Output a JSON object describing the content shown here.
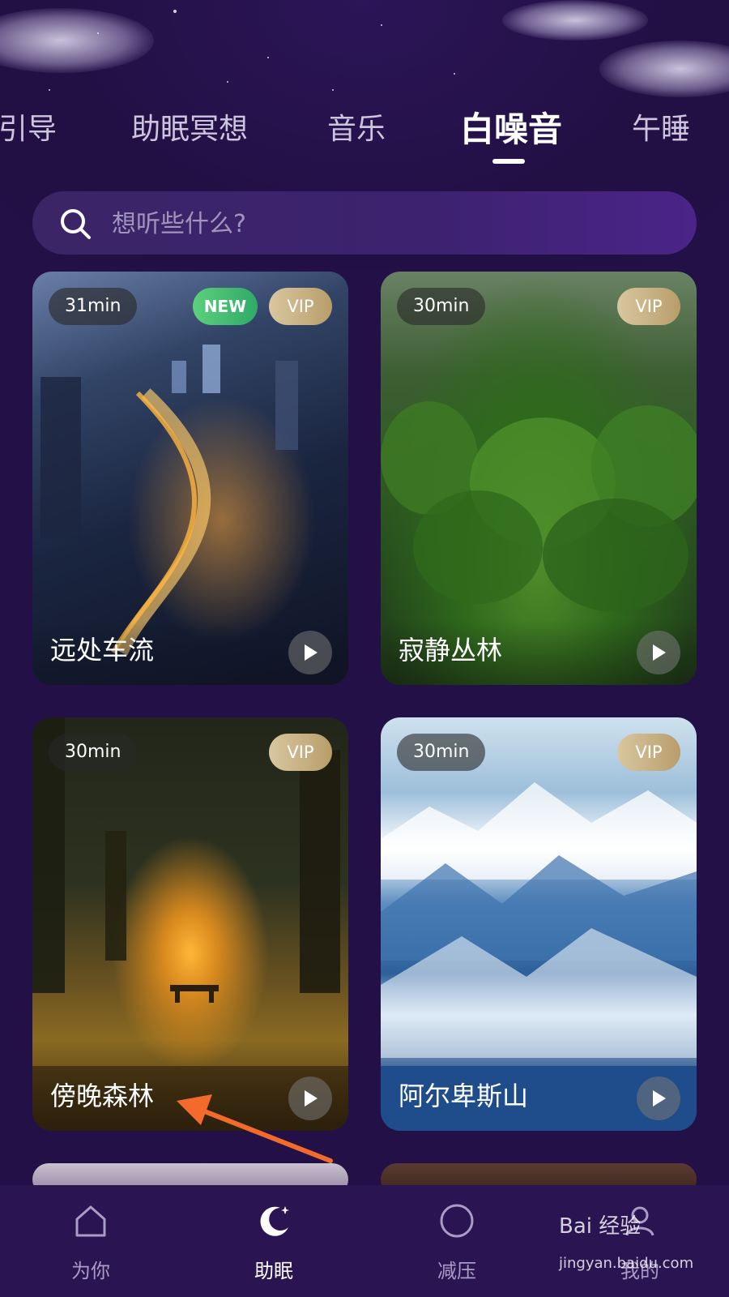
{
  "tabs": [
    {
      "label": "引导"
    },
    {
      "label": "助眠冥想"
    },
    {
      "label": "音乐"
    },
    {
      "label": "白噪音",
      "active": true
    },
    {
      "label": "午睡"
    }
  ],
  "search": {
    "placeholder": "想听些什么?"
  },
  "cards": [
    {
      "title": "远处车流",
      "duration": "31min",
      "new_badge": "NEW",
      "vip_badge": "VIP"
    },
    {
      "title": "寂静丛林",
      "duration": "30min",
      "vip_badge": "VIP"
    },
    {
      "title": "傍晚森林",
      "duration": "30min",
      "vip_badge": "VIP"
    },
    {
      "title": "阿尔卑斯山",
      "duration": "30min",
      "vip_badge": "VIP"
    }
  ],
  "bottom_nav": [
    {
      "label": "为你",
      "icon": "home-icon"
    },
    {
      "label": "助眠",
      "icon": "moon-icon",
      "active": true
    },
    {
      "label": "减压",
      "icon": "circle-icon"
    },
    {
      "label": "我的",
      "icon": "profile-icon"
    }
  ],
  "watermark": {
    "brand": "Bai 经验",
    "url": "jingyan.baidu.com"
  },
  "colors": {
    "background": "#231046",
    "accent": "#ffffff",
    "nav_inactive": "#a89dc6",
    "arrow": "#f26b2c"
  }
}
